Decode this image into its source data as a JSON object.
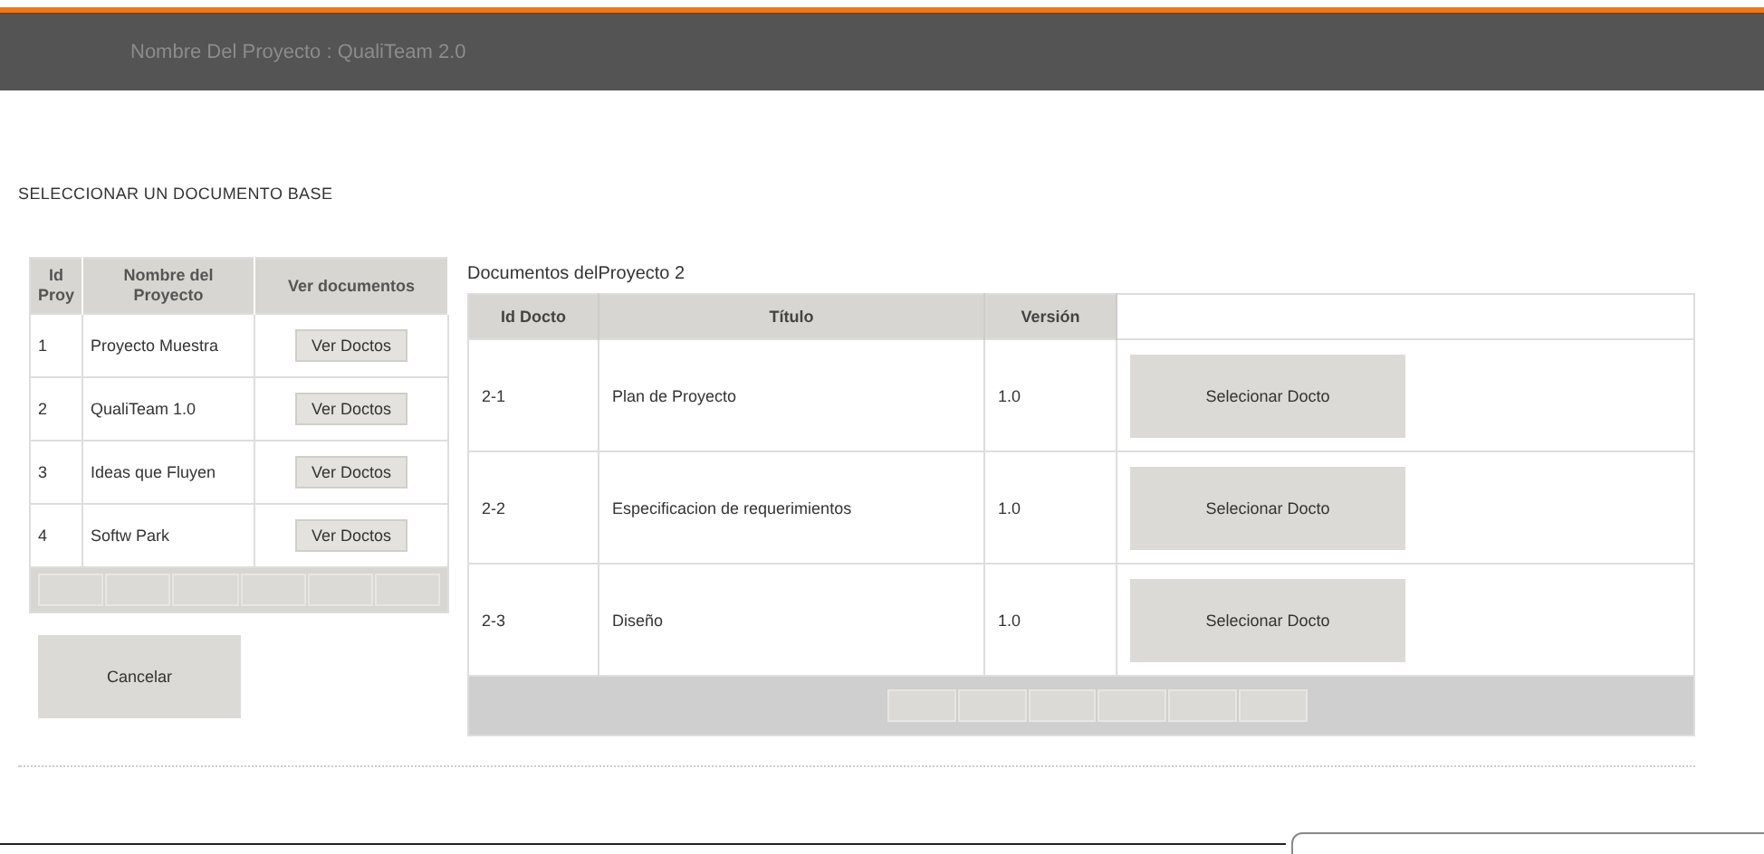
{
  "header": {
    "title": "Nombre Del Proyecto : QualiTeam 2.0"
  },
  "section_title": "SELECCIONAR UN DOCUMENTO BASE",
  "projects_table": {
    "columns": [
      "Id Proy",
      "Nombre del Proyecto",
      "Ver documentos"
    ],
    "rows": [
      {
        "id": "1",
        "name": "Proyecto Muestra",
        "action": "Ver Doctos"
      },
      {
        "id": "2",
        "name": "QualiTeam 1.0",
        "action": "Ver Doctos"
      },
      {
        "id": "3",
        "name": "Ideas que Fluyen",
        "action": "Ver Doctos"
      },
      {
        "id": "4",
        "name": "Softw Park",
        "action": "Ver Doctos"
      }
    ],
    "pager": [
      {
        "disabled": true
      },
      {
        "disabled": true
      },
      {
        "disabled": true
      },
      {
        "disabled": true
      },
      {
        "disabled": true
      },
      {
        "disabled": true
      }
    ]
  },
  "cancel_button": "Cancelar",
  "documents_title": "Documentos delProyecto 2",
  "documents_table": {
    "columns": [
      "Id Docto",
      "Título",
      "Versión"
    ],
    "rows": [
      {
        "id": "2-1",
        "title": "Plan de Proyecto",
        "version": "1.0",
        "action": "Selecionar Docto"
      },
      {
        "id": "2-2",
        "title": "Especificacion de requerimientos",
        "version": "1.0",
        "action": "Selecionar Docto"
      },
      {
        "id": "2-3",
        "title": "Diseño",
        "version": "1.0",
        "action": "Selecionar Docto"
      }
    ],
    "pager": [
      {
        "disabled": true
      },
      {
        "disabled": true
      },
      {
        "disabled": true
      },
      {
        "disabled": true
      },
      {
        "disabled": true
      },
      {
        "disabled": true
      }
    ]
  }
}
